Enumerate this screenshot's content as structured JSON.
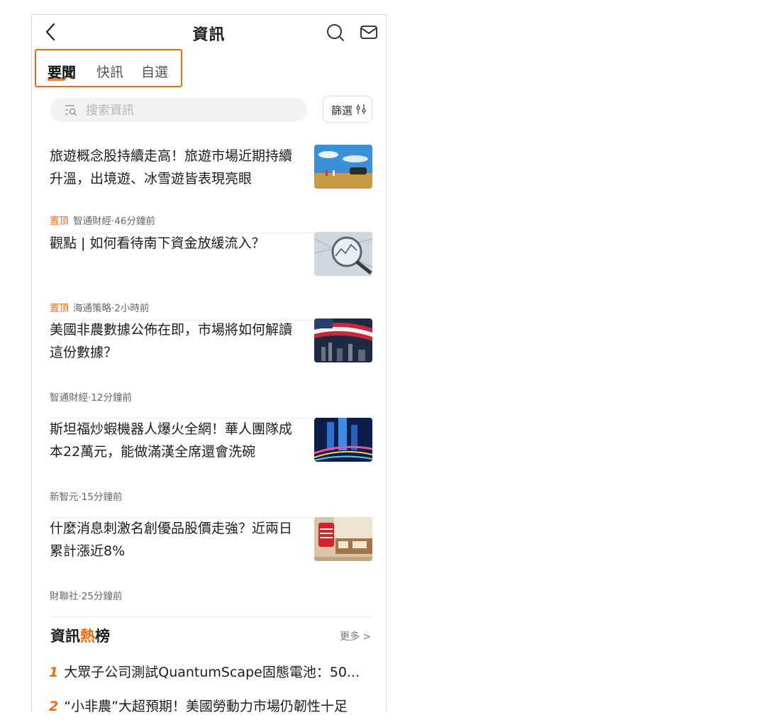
{
  "header": {
    "title": "資訊"
  },
  "tabs": [
    {
      "label": "要聞",
      "active": true
    },
    {
      "label": "快訊",
      "active": false
    },
    {
      "label": "自選",
      "active": false
    }
  ],
  "search": {
    "placeholder": "搜索資訊"
  },
  "filter": {
    "label": "篩選"
  },
  "news": [
    {
      "headline": "旅遊概念股持續走高！旅遊市場近期持續升溫，出境遊、冰雪遊皆表現亮眼",
      "pinned_label": "置頂",
      "source_time": "智通財經·46分鐘前",
      "thumb": "travel-photo"
    },
    {
      "headline": "觀點 | 如何看待南下資金放緩流入？",
      "pinned_label": "置頂",
      "source_time": "海通策略·2小時前",
      "thumb": "magnifier-chart-photo"
    },
    {
      "headline": "美國非農數據公佈在即，市場將如何解讀這份數據？",
      "pinned_label": "",
      "source_time": "智通財經·12分鐘前",
      "thumb": "us-flag-skyline-photo"
    },
    {
      "headline": "斯坦福炒蝦機器人爆火全網！華人團隊成本22萬元，能做滿漢全席還會洗碗",
      "pinned_label": "",
      "source_time": "新智元·15分鐘前",
      "thumb": "city-night-photo"
    },
    {
      "headline": "什麼消息刺激名創優品股價走強？近兩日累計漲近8%",
      "pinned_label": "",
      "source_time": "財聯社·25分鐘前",
      "thumb": "miniso-store-photo"
    }
  ],
  "hot": {
    "title_a": "資訊",
    "title_b": "熱",
    "title_c": "榜",
    "more_label": "更多 >",
    "items": [
      {
        "rank": "1",
        "text": "大眾子公司測試QuantumScape固態電池：50..."
      },
      {
        "rank": "2",
        "text": "“小非農”大超預期！美國勞動力市場仍韌性十足"
      }
    ]
  },
  "colors": {
    "accent": "#f06a14"
  }
}
